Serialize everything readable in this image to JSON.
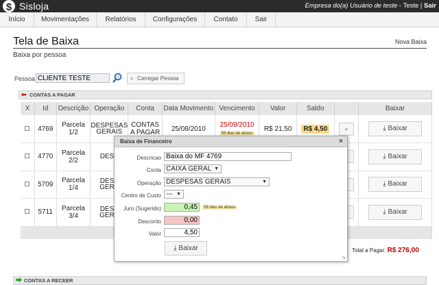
{
  "app": {
    "name": "Sisloja",
    "logo": "$"
  },
  "topbar": {
    "company": "Empresa do(a) Usuário de teste",
    "sep1": " - ",
    "user": "Teste",
    "sep2": " | ",
    "logout": "Sair"
  },
  "menu": [
    {
      "label": "Início"
    },
    {
      "label": "Movimentações"
    },
    {
      "label": "Relatórios"
    },
    {
      "label": "Configurações"
    },
    {
      "label": "Contato"
    },
    {
      "label": "Sair"
    }
  ],
  "page": {
    "title": "Tela de Baixa",
    "subtitle": "Baixa por pessoa",
    "nova_baixa": "Nova Baixa"
  },
  "pessoa": {
    "label": "Pessoa",
    "value": "CLIENTE TESTE",
    "load_button": "Carregar Pessoa"
  },
  "contas_pagar": {
    "header": "CONTAS A PAGAR",
    "columns": [
      "X",
      "Id",
      "Descrição",
      "Operação",
      "Conta",
      "Data Movimento",
      "Vencimento",
      "Valor",
      "Saldo",
      "",
      "Baixar"
    ],
    "rows": [
      {
        "id": "4769",
        "descricao": "Parcela 1/2",
        "operacao": "DESPESAS GERAIS",
        "conta": "CONTAS A PAGAR",
        "data": "25/08/2010",
        "venc": "25/09/2010",
        "atraso": "59 dias de atraso",
        "valor": "R$ 21,50",
        "saldo": "R$ 4,50",
        "baixar": "Baixar"
      },
      {
        "id": "4770",
        "descricao": "Parcela 2/2",
        "operacao": "DESP",
        "conta": "",
        "data": "",
        "venc": "",
        "atraso": "",
        "valor": "",
        "saldo": "",
        "baixar": "Baixar"
      },
      {
        "id": "5709",
        "descricao": "Parcela 1/4",
        "operacao": "DESP GERA",
        "conta": "",
        "data": "",
        "venc": "",
        "atraso": "",
        "valor": "",
        "saldo": "",
        "baixar": "Baixar"
      },
      {
        "id": "5711",
        "descricao": "Parcela 3/4",
        "operacao": "DESP GERA",
        "conta": "",
        "data": "",
        "venc": "",
        "atraso": "",
        "valor": "",
        "saldo": "",
        "baixar": "Baixar"
      }
    ],
    "total_label": "Total a Pagar:",
    "total_value": "R$ 276,00"
  },
  "contas_receber": {
    "header": "CONTAS A RECEER"
  },
  "modal": {
    "title": "Baixa de Financeiro",
    "close": "×",
    "descricao_label": "Descricao",
    "descricao_value": "Baixa do MF 4769",
    "conta_label": "Conta",
    "conta_value": "CAIXA GERAL",
    "operacao_label": "Operação",
    "operacao_value": "DESPESAS GERAIS",
    "centro_label": "Centro de Custo",
    "centro_value": "---",
    "juro_label": "Juro (Sugerido)",
    "juro_value": "0,45",
    "juro_note": "59 dias de atraso",
    "desconto_label": "Desconto",
    "desconto_value": "0,00",
    "valor_label": "Valor",
    "valor_value": "4,50",
    "baixar_button": "Baixar"
  },
  "colors": {
    "topbar": "#2b2b2b",
    "overdue": "#c40000",
    "juro_bg": "#c8f5b4",
    "desconto_bg": "#f7c4c4",
    "saldo_bg": "#fbd98a",
    "arrow_red": "#cc1111",
    "arrow_green": "#22aa22"
  }
}
